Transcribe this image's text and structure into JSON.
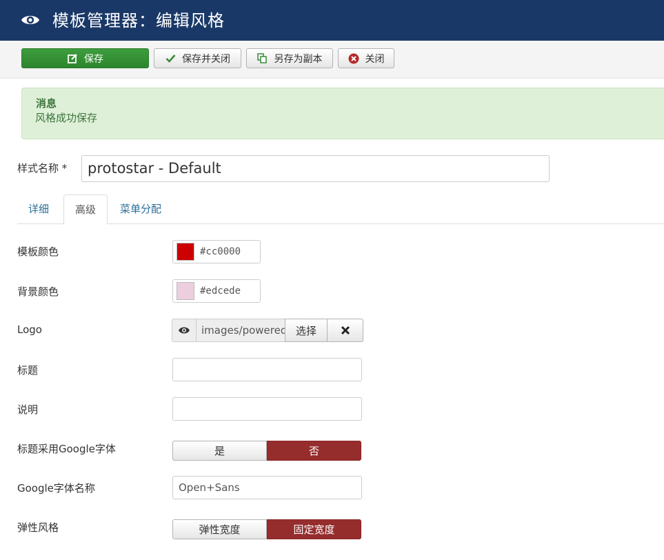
{
  "header": {
    "title": "模板管理器：编辑风格",
    "icon": "eye-icon",
    "background": "#1a3867"
  },
  "toolbar": {
    "save_label": "保存",
    "save_close_label": "保存并关闭",
    "save_copy_label": "另存为副本",
    "close_label": "关闭",
    "save_color": "#2f8a2f"
  },
  "alert": {
    "heading": "消息",
    "text": "风格成功保存"
  },
  "form": {
    "style_name_label": "样式名称 *",
    "style_name_value": "protostar - Default"
  },
  "tabs": [
    {
      "label": "详细",
      "active": false
    },
    {
      "label": "高级",
      "active": true
    },
    {
      "label": "菜单分配",
      "active": false
    }
  ],
  "advanced": {
    "template_color_label": "模板颜色",
    "template_color_value": "#cc0000",
    "background_color_label": "背景颜色",
    "background_color_value": "#edcede",
    "logo_label": "Logo",
    "logo_value": "images/powered",
    "logo_select_label": "选择",
    "title_label": "标题",
    "title_value": "",
    "description_label": "说明",
    "description_value": "",
    "google_font_label": "标题采用Google字体",
    "google_font_yes": "是",
    "google_font_no": "否",
    "google_font_name_label": "Google字体名称",
    "google_font_name_value": "Open+Sans",
    "fluid_label": "弹性风格",
    "fluid_option": "弹性宽度",
    "fixed_option": "固定宽度",
    "active_toggle_color": "#962d2d"
  }
}
